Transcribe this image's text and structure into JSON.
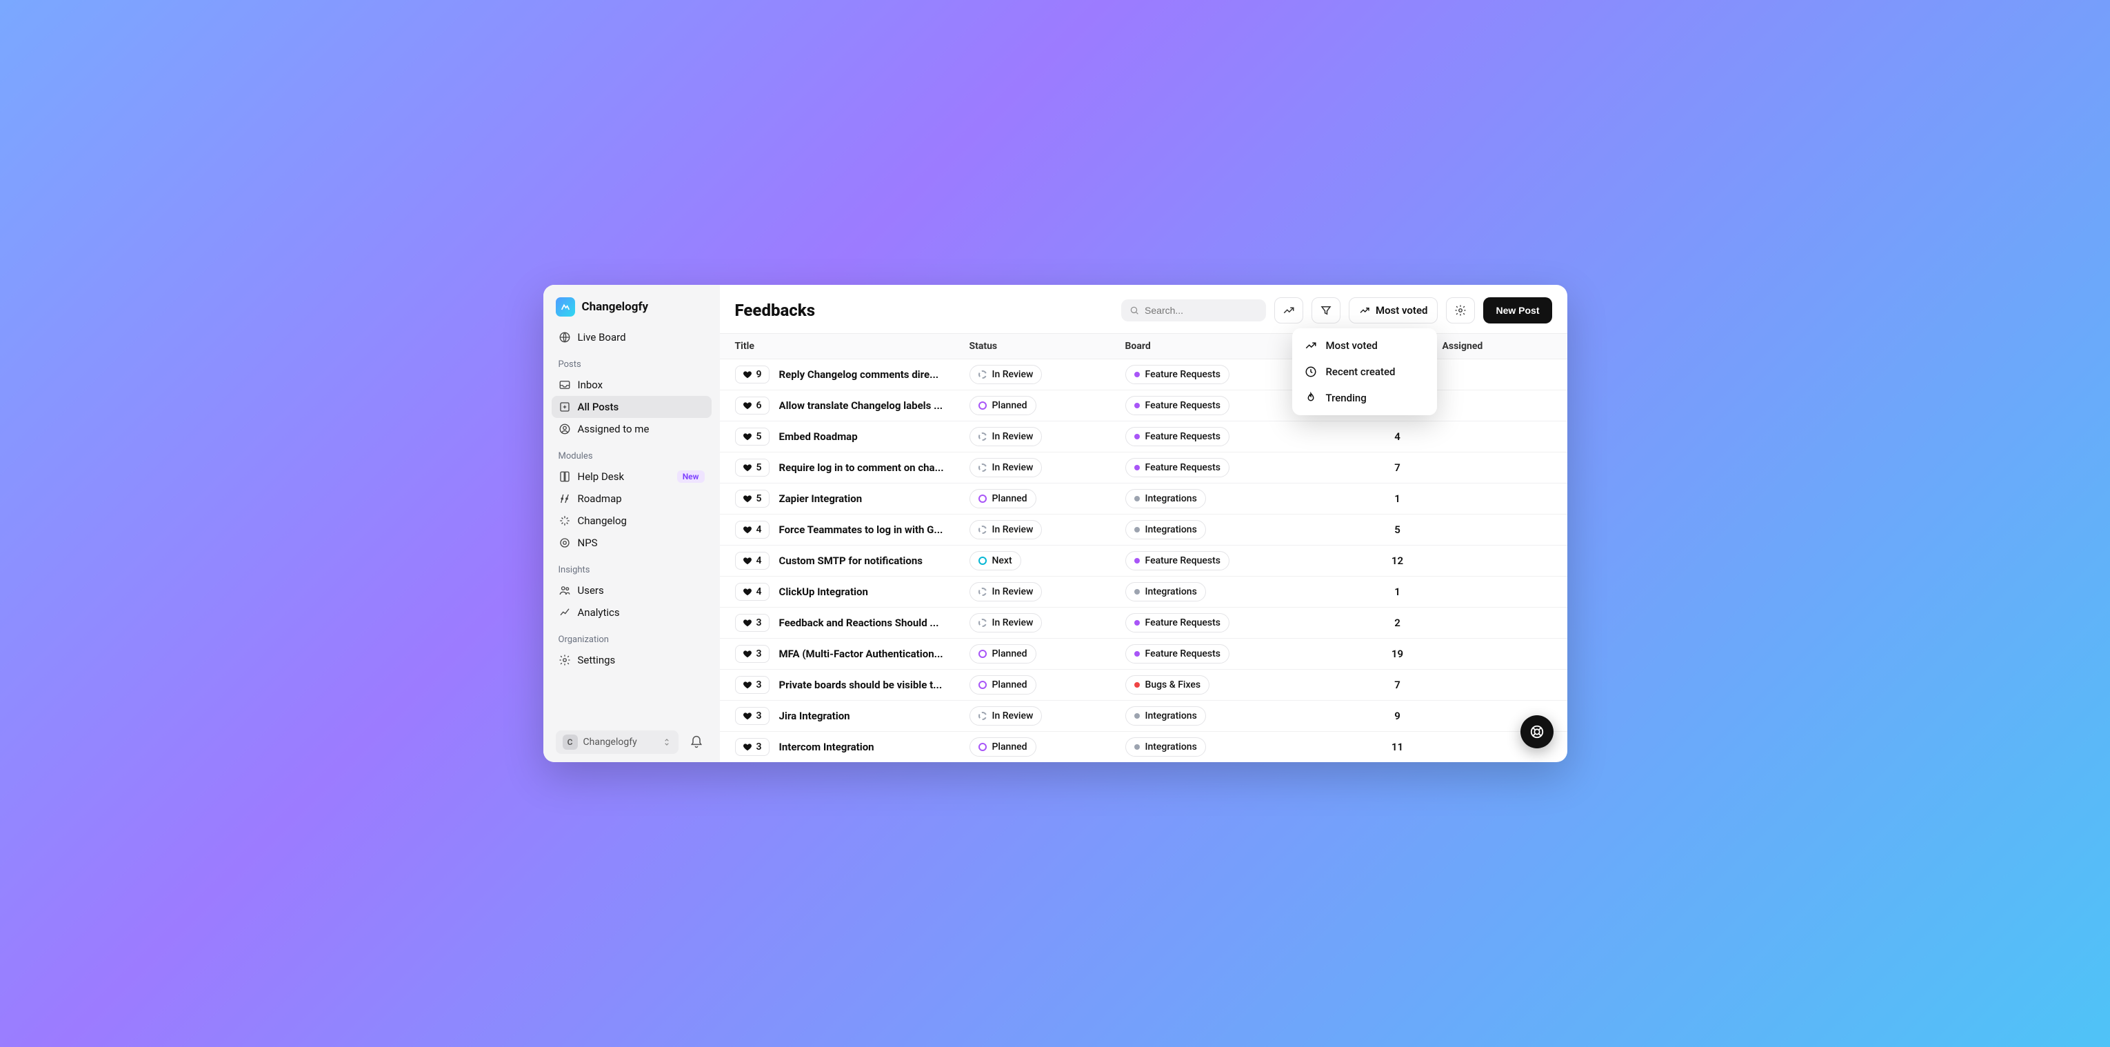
{
  "brand": {
    "name": "Changelogfy"
  },
  "sidebar": {
    "liveBoard": "Live Board",
    "postsHeading": "Posts",
    "modulesHeading": "Modules",
    "insightsHeading": "Insights",
    "orgHeading": "Organization",
    "inbox": "Inbox",
    "allPosts": "All Posts",
    "assignedToMe": "Assigned to me",
    "helpDesk": "Help Desk",
    "helpDeskBadge": "New",
    "roadmap": "Roadmap",
    "changelog": "Changelog",
    "nps": "NPS",
    "users": "Users",
    "analytics": "Analytics",
    "settings": "Settings"
  },
  "footer": {
    "workspaceInitial": "C",
    "workspaceName": "Changelogfy"
  },
  "header": {
    "title": "Feedbacks",
    "searchPlaceholder": "Search...",
    "sortLabel": "Most voted",
    "newPost": "New Post"
  },
  "sortMenu": {
    "mostVoted": "Most voted",
    "recentCreated": "Recent created",
    "trending": "Trending"
  },
  "columns": {
    "title": "Title",
    "status": "Status",
    "board": "Board",
    "assigned": "Assigned"
  },
  "rows": [
    {
      "votes": 9,
      "title": "Reply Changelog comments dire...",
      "status": "In Review",
      "statusStyle": "dashed-gray",
      "board": "Feature Requests",
      "boardColor": "purple",
      "count": ""
    },
    {
      "votes": 6,
      "title": "Allow translate Changelog labels ...",
      "status": "Planned",
      "statusStyle": "solid-purple",
      "board": "Feature Requests",
      "boardColor": "purple",
      "count": ""
    },
    {
      "votes": 5,
      "title": "Embed Roadmap",
      "status": "In Review",
      "statusStyle": "dashed-gray",
      "board": "Feature Requests",
      "boardColor": "purple",
      "count": "4"
    },
    {
      "votes": 5,
      "title": "Require log in to comment on cha...",
      "status": "In Review",
      "statusStyle": "dashed-gray",
      "board": "Feature Requests",
      "boardColor": "purple",
      "count": "7"
    },
    {
      "votes": 5,
      "title": "Zapier Integration",
      "status": "Planned",
      "statusStyle": "solid-purple",
      "board": "Integrations",
      "boardColor": "gray",
      "count": "1"
    },
    {
      "votes": 4,
      "title": "Force Teammates to log in with G...",
      "status": "In Review",
      "statusStyle": "dashed-gray",
      "board": "Integrations",
      "boardColor": "gray",
      "count": "5"
    },
    {
      "votes": 4,
      "title": "Custom SMTP for notifications",
      "status": "Next",
      "statusStyle": "solid-cyan",
      "board": "Feature Requests",
      "boardColor": "purple",
      "count": "12"
    },
    {
      "votes": 4,
      "title": "ClickUp Integration",
      "status": "In Review",
      "statusStyle": "dashed-gray",
      "board": "Integrations",
      "boardColor": "gray",
      "count": "1"
    },
    {
      "votes": 3,
      "title": "Feedback and Reactions Should ...",
      "status": "In Review",
      "statusStyle": "dashed-gray",
      "board": "Feature Requests",
      "boardColor": "purple",
      "count": "2"
    },
    {
      "votes": 3,
      "title": "MFA (Multi-Factor Authentication...",
      "status": "Planned",
      "statusStyle": "solid-purple",
      "board": "Feature Requests",
      "boardColor": "purple",
      "count": "19"
    },
    {
      "votes": 3,
      "title": "Private boards should be visible t...",
      "status": "Planned",
      "statusStyle": "solid-purple",
      "board": "Bugs & Fixes",
      "boardColor": "red",
      "count": "7"
    },
    {
      "votes": 3,
      "title": "Jira Integration",
      "status": "In Review",
      "statusStyle": "dashed-gray",
      "board": "Integrations",
      "boardColor": "gray",
      "count": "9"
    },
    {
      "votes": 3,
      "title": "Intercom Integration",
      "status": "Planned",
      "statusStyle": "solid-purple",
      "board": "Integrations",
      "boardColor": "gray",
      "count": "11"
    }
  ]
}
